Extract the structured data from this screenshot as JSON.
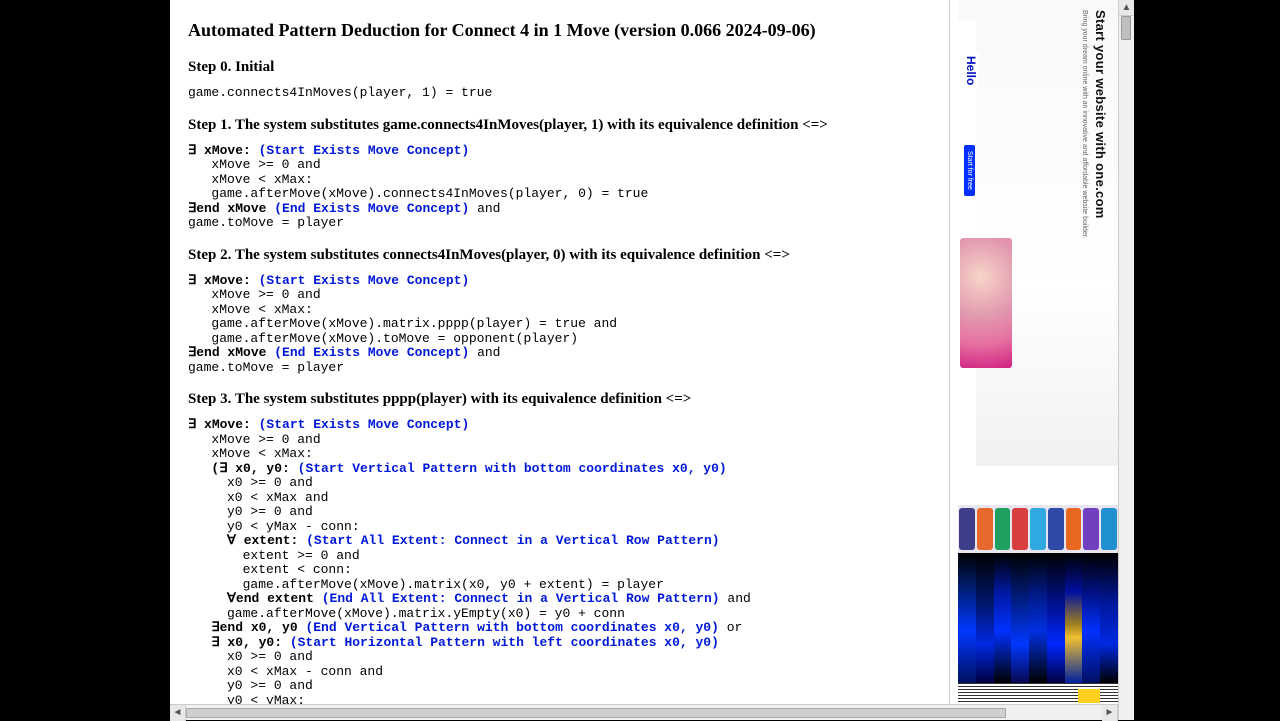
{
  "title": "Automated Pattern Deduction for Connect 4 in 1 Move (version 0.066 2024-09-06)",
  "step0": {
    "heading": "Step 0. Initial",
    "code": "game.connects4InMoves(player, 1) = true"
  },
  "step1": {
    "heading": "Step 1. The system substitutes game.connects4InMoves(player, 1) with its equivalence definition <=>",
    "l1a": "∃ xMove:",
    "l1b": " (Start Exists Move Concept)",
    "l2": "   xMove >= 0 and",
    "l3": "   xMove < xMax:",
    "l4": "   game.afterMove(xMove).connects4InMoves(player, 0) = true",
    "l5a": "∃end xMove",
    "l5b": " (End Exists Move Concept)",
    "l5c": " and",
    "l6": "game.toMove = player"
  },
  "step2": {
    "heading": "Step 2. The system substitutes connects4InMoves(player, 0) with its equivalence definition <=>",
    "l1a": "∃ xMove:",
    "l1b": " (Start Exists Move Concept)",
    "l2": "   xMove >= 0 and",
    "l3": "   xMove < xMax:",
    "l4": "   game.afterMove(xMove).matrix.pppp(player) = true and",
    "l5": "   game.afterMove(xMove).toMove = opponent(player)",
    "l6a": "∃end xMove",
    "l6b": " (End Exists Move Concept)",
    "l6c": " and",
    "l7": "game.toMove = player"
  },
  "step3": {
    "heading": "Step 3. The system substitutes pppp(player) with its equivalence definition <=>",
    "l1a": "∃ xMove:",
    "l1b": " (Start Exists Move Concept)",
    "l2": "   xMove >= 0 and",
    "l3": "   xMove < xMax:",
    "l4a": "   (∃ x0, y0:",
    "l4b": " (Start Vertical Pattern with bottom coordinates x0, y0)",
    "l5": "     x0 >= 0 and",
    "l6": "     x0 < xMax and",
    "l7": "     y0 >= 0 and",
    "l8": "     y0 < yMax - conn:",
    "l9a": "     ∀ extent:",
    "l9b": " (Start All Extent: Connect in a Vertical Row Pattern)",
    "l10": "       extent >= 0 and",
    "l11": "       extent < conn:",
    "l12": "       game.afterMove(xMove).matrix(x0, y0 + extent) = player",
    "l13a": "     ∀end extent",
    "l13b": " (End All Extent: Connect in a Vertical Row Pattern)",
    "l13c": " and",
    "l14": "     game.afterMove(xMove).matrix.yEmpty(x0) = y0 + conn",
    "l15a": "   ∃end x0, y0",
    "l15b": " (End Vertical Pattern with bottom coordinates x0, y0)",
    "l15c": " or",
    "l16a": "   ∃ x0, y0:",
    "l16b": " (Start Horizontal Pattern with left coordinates x0, y0)",
    "l17": "     x0 >= 0 and",
    "l18": "     x0 < xMax - conn and",
    "l19": "     y0 >= 0 and",
    "l20": "     y0 < yMax:"
  },
  "ad1": {
    "headline": "Start your website with one.com",
    "sub": "Bring your dream online with an innovative and affordable website builder.",
    "hello": "Hello",
    "cta": "Start for free"
  }
}
